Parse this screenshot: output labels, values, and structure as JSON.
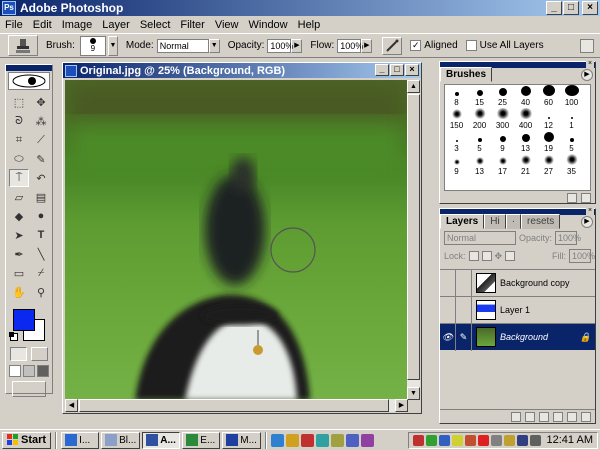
{
  "app": {
    "title": "Adobe Photoshop",
    "colors": {
      "title_bar": "#0a246a",
      "foreground_color": "#0a28f0",
      "background_color": "#ffffff"
    }
  },
  "menu": [
    "File",
    "Edit",
    "Image",
    "Layer",
    "Select",
    "Filter",
    "View",
    "Window",
    "Help"
  ],
  "options": {
    "brush_label": "Brush:",
    "brush_size": "9",
    "mode_label": "Mode:",
    "mode_value": "Normal",
    "opacity_label": "Opacity:",
    "opacity_value": "100%",
    "flow_label": "Flow:",
    "flow_value": "100%",
    "aligned_label": "Aligned",
    "aligned_checked": true,
    "all_layers_label": "Use All Layers",
    "all_layers_checked": false
  },
  "document": {
    "title": "Original.jpg @ 25% (Background, RGB)"
  },
  "brushes_panel": {
    "tab": "Brushes",
    "brushes": [
      {
        "label": "8",
        "r": 2
      },
      {
        "label": "15",
        "r": 3
      },
      {
        "label": "25",
        "r": 4
      },
      {
        "label": "40",
        "r": 5
      },
      {
        "label": "60",
        "r": 6
      },
      {
        "label": "100",
        "r": 7
      },
      {
        "label": "150",
        "r": 5,
        "soft": true
      },
      {
        "label": "200",
        "r": 6,
        "soft": true
      },
      {
        "label": "300",
        "r": 7,
        "soft": true
      },
      {
        "label": "400",
        "r": 7,
        "soft": true
      },
      {
        "label": "12",
        "r": 1
      },
      {
        "label": "1",
        "r": 1
      },
      {
        "label": "3",
        "r": 1
      },
      {
        "label": "5",
        "r": 2
      },
      {
        "label": "9",
        "r": 3
      },
      {
        "label": "13",
        "r": 4
      },
      {
        "label": "19",
        "r": 5
      },
      {
        "label": "5",
        "r": 2
      },
      {
        "label": "9",
        "r": 3,
        "soft": true
      },
      {
        "label": "13",
        "r": 4,
        "soft": true
      },
      {
        "label": "17",
        "r": 4,
        "soft": true
      },
      {
        "label": "21",
        "r": 5,
        "soft": true
      },
      {
        "label": "27",
        "r": 5,
        "soft": true
      },
      {
        "label": "35",
        "r": 6,
        "soft": true
      }
    ]
  },
  "layers_panel": {
    "tabs": [
      "Layers",
      "Hi",
      "·",
      "·",
      "resets"
    ],
    "mode": "Normal",
    "opacity_label": "Opacity:",
    "opacity_value": "100%",
    "lock_label": "Lock:",
    "fill_label": "Fill:",
    "fill_value": "100%",
    "layers": [
      {
        "name": "Background copy",
        "visible": false,
        "selected": false
      },
      {
        "name": "Layer 1",
        "visible": false,
        "selected": false
      },
      {
        "name": "Background",
        "visible": true,
        "selected": true,
        "locked": true
      }
    ]
  },
  "taskbar": {
    "start_label": "Start",
    "tasks": [
      {
        "label": "I...",
        "active": false
      },
      {
        "label": "Bl...",
        "active": false
      },
      {
        "label": "A...",
        "active": true
      },
      {
        "label": "E...",
        "active": false
      },
      {
        "label": "M...",
        "active": false
      }
    ],
    "clock": "12:41 AM"
  }
}
